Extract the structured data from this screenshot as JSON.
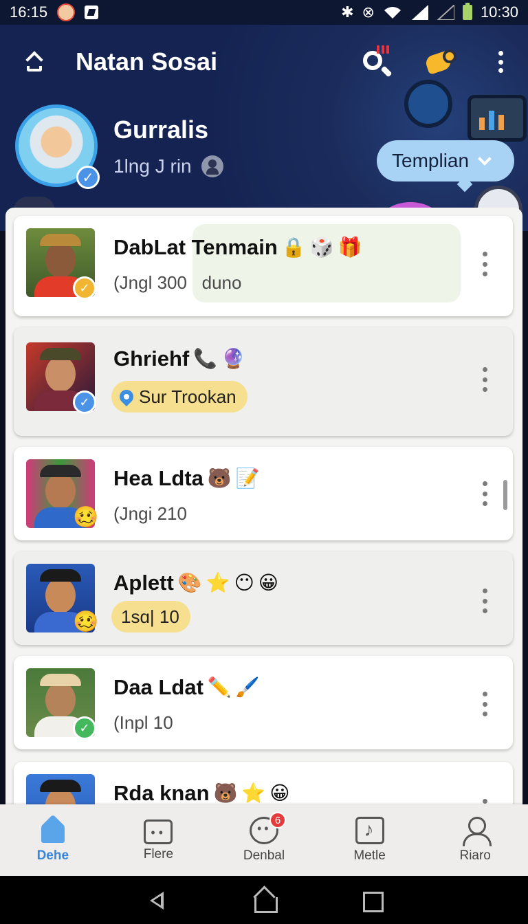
{
  "status_bar": {
    "left_time": "16:15",
    "right_time": "10:30",
    "icons": [
      "notification-face-icon",
      "notification-app-icon",
      "bluetooth-icon",
      "nfc-icon",
      "wifi-icon",
      "signal-icon",
      "signal-empty-icon",
      "battery-icon"
    ]
  },
  "header": {
    "title": "Natan Sosai",
    "profile_name": "Gurralis",
    "profile_sub": "1lng J rin",
    "template_button": "Templian"
  },
  "contacts": [
    {
      "name": "DabLat Tenmain",
      "emojis": [
        "🔒",
        "🎲",
        "🎁"
      ],
      "subtitle": "(Jngl 300",
      "subtitle_extra": "duno",
      "badge": "verified-gold",
      "style": "highlight"
    },
    {
      "name": "Ghriehf",
      "emojis": [
        "📞",
        "🔮"
      ],
      "subtitle": "Sur Trookan",
      "badge": "verified-blue",
      "style": "location-pill"
    },
    {
      "name": "Hea Ldta",
      "emojis": [
        "🐻",
        "📝"
      ],
      "subtitle": "(Jngi 210",
      "badge": "emoji",
      "style": "plain"
    },
    {
      "name": "Aplett",
      "emojis": [
        "🎨",
        "⭐",
        "😶",
        "😀"
      ],
      "subtitle": "1sɑ| 10",
      "badge": "emoji",
      "style": "yellow-pill"
    },
    {
      "name": "Daa Ldat",
      "emojis": [
        "✏️",
        "🖌️"
      ],
      "subtitle": "(Inpl 10",
      "badge": "verified-green",
      "style": "plain"
    },
    {
      "name": "Rda knan",
      "emojis": [
        "🐻",
        "⭐",
        "😀"
      ],
      "subtitle": "",
      "badge": "none",
      "style": "plain"
    }
  ],
  "bottom_nav": [
    {
      "label": "Dehe",
      "icon": "home-icon",
      "active": true
    },
    {
      "label": "Flere",
      "icon": "shop-icon",
      "active": false
    },
    {
      "label": "Denbal",
      "icon": "face-icon",
      "badge": "6",
      "active": false
    },
    {
      "label": "Metle",
      "icon": "music-icon",
      "active": false
    },
    {
      "label": "Riaro",
      "icon": "user-icon",
      "active": false
    }
  ],
  "colors": {
    "header_bg": "#1b2c5c",
    "accent_blue": "#3a86d8",
    "pill_yellow": "#f6df8e",
    "template_button_bg": "#a9d3f5"
  }
}
